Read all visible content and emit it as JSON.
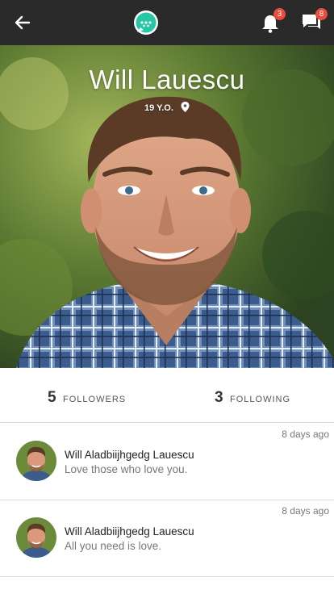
{
  "header": {
    "back_icon": "arrow-left-icon",
    "logo_icon": "chat-bubble-logo-icon",
    "notifications": {
      "icon": "bell-icon",
      "count": "3"
    },
    "messages": {
      "icon": "chat-icon",
      "count": "8"
    },
    "colors": {
      "bar": "#2a2a2a",
      "logo": "#26c6a6",
      "badge": "#e74c3c"
    }
  },
  "profile": {
    "name": "Will Lauescu",
    "age": "19 Y.O.",
    "location_icon": "map-pin-icon"
  },
  "stats": {
    "followers": {
      "count": "5",
      "label": "FOLLOWERS"
    },
    "following": {
      "count": "3",
      "label": "FOLLOWING"
    }
  },
  "posts": [
    {
      "time": "8 days ago",
      "author": "Will Aladbiijhgedg Lauescu",
      "text": "Love those who love you."
    },
    {
      "time": "8 days ago",
      "author": "Will Aladbiijhgedg Lauescu",
      "text": "All you need is love."
    }
  ]
}
